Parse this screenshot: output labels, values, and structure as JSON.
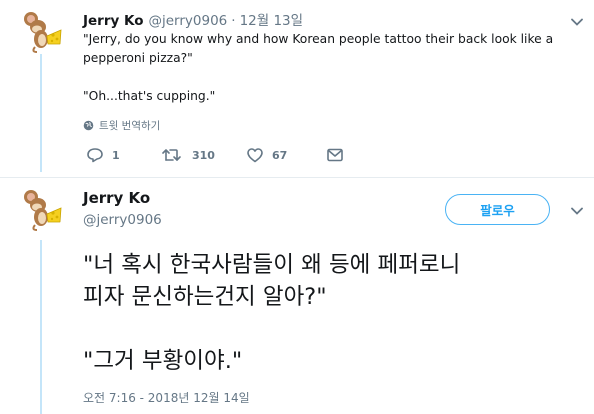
{
  "tweet1": {
    "name": "Jerry Ko",
    "handle": "@jerry0906",
    "separator": "·",
    "date": "12월 13일",
    "lines": [
      "\"Jerry, do you know why and how Korean people tattoo their back look like a",
      "pepperoni pizza?\"",
      "\"Oh...that's cupping.\""
    ],
    "translate_label": "트윗 번역하기",
    "translate_icon": "globe-icon",
    "reply_count": "1",
    "retweet_count": "310",
    "like_count": "67",
    "icons": [
      "reply-icon",
      "retweet-icon",
      "heart-icon",
      "direct-message-icon",
      "chevron-down-icon"
    ]
  },
  "tweet2": {
    "name": "Jerry Ko",
    "handle": "@jerry0906",
    "follow_label": "팔로우",
    "lines": [
      "\"너 혹시 한국사람들이 왜 등에 페퍼로니",
      "피자 문신하는건지 알아?\"",
      "\"그거 부황이야.\""
    ],
    "timestamp": "오전 7:16 - 2018년 12월 14일"
  },
  "colors": {
    "text": "#14171a",
    "muted": "#657786",
    "accent": "#1da1f2",
    "thread_line": "#c4e5f9",
    "divider": "#e6ecf0"
  }
}
